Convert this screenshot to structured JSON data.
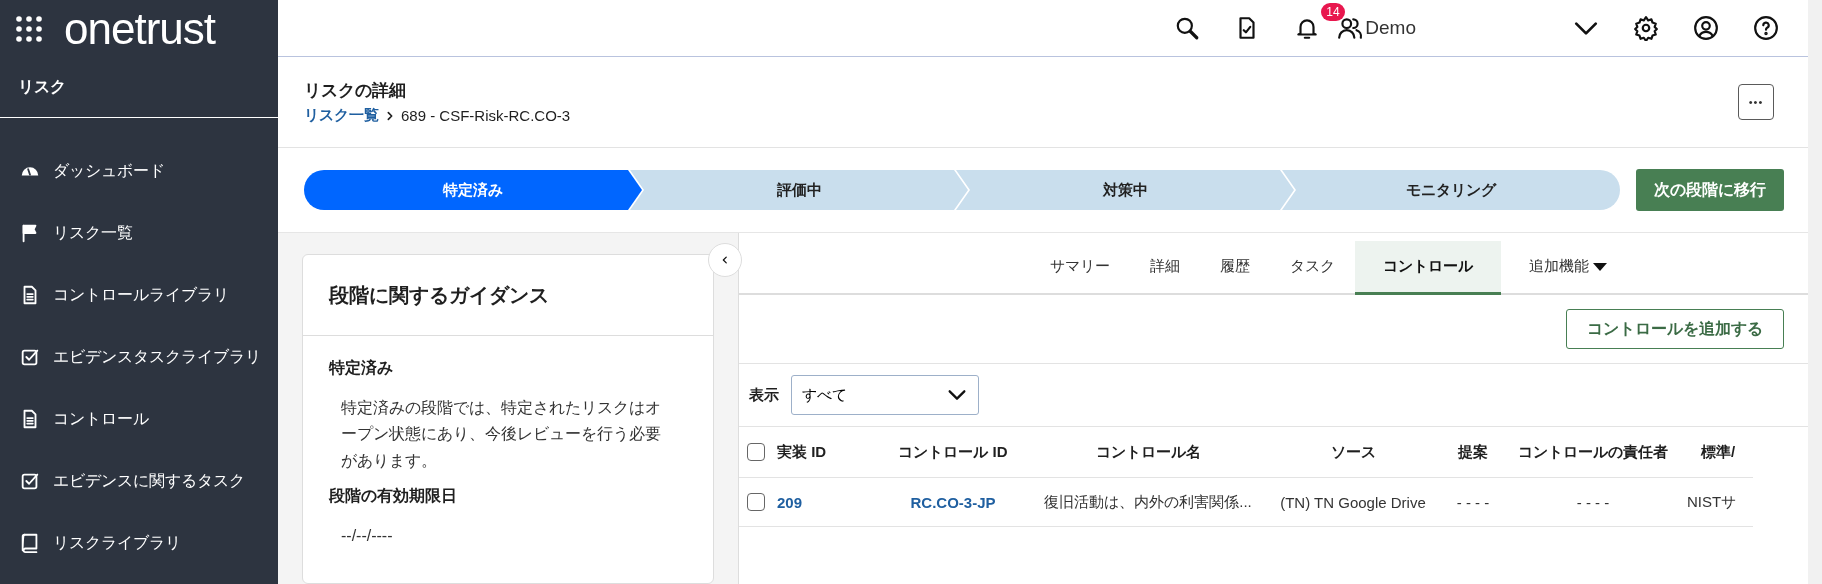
{
  "brand": {
    "logo": "onetrust",
    "module": "リスク"
  },
  "sidebar": {
    "items": [
      {
        "label": "ダッシュボード",
        "kind": "dashboard"
      },
      {
        "label": "リスク一覧",
        "kind": "flag"
      },
      {
        "label": "コントロールライブラリ",
        "kind": "document"
      },
      {
        "label": "エビデンスタスクライブラリ",
        "kind": "task"
      },
      {
        "label": "コントロール",
        "kind": "document"
      },
      {
        "label": "エビデンスに関するタスク",
        "kind": "task"
      },
      {
        "label": "リスクライブラリ",
        "kind": "book"
      }
    ]
  },
  "topbar": {
    "notifications": "14",
    "user": "Demo"
  },
  "header": {
    "title": "リスクの詳細",
    "breadcrumb_link": "リスク一覧",
    "breadcrumb_current": "689 - CSF-Risk-RC.CO-3",
    "more": "•••"
  },
  "stages": [
    {
      "label": "特定済み",
      "selected": true
    },
    {
      "label": "評価中",
      "selected": false
    },
    {
      "label": "対策中",
      "selected": false
    },
    {
      "label": "モニタリング",
      "selected": false
    }
  ],
  "next_stage_button": "次の段階に移行",
  "guidance": {
    "title": "段階に関するガイダンス",
    "stage_heading": "特定済み",
    "description": "特定済みの段階では、特定されたリスクはオープン状態にあり、今後レビューを行う必要があります。",
    "expiry_heading": "段階の有効期限日",
    "expiry_value": "--/--/----"
  },
  "tabs": [
    {
      "label": "サマリー",
      "selected": false
    },
    {
      "label": "詳細",
      "selected": false
    },
    {
      "label": "履歴",
      "selected": false
    },
    {
      "label": "タスク",
      "selected": false
    },
    {
      "label": "コントロール",
      "selected": true
    },
    {
      "label": "追加機能",
      "selected": false,
      "kind": "menu"
    }
  ],
  "add_control_button": "コントロールを追加する",
  "filter": {
    "label": "表示",
    "value": "すべて"
  },
  "table": {
    "all_checked": false,
    "columns": [
      "実装 ID",
      "コントロール ID",
      "コントロール名",
      "ソース",
      "提案",
      "コントロールの責任者",
      "標準/"
    ],
    "rows": [
      {
        "checked": false,
        "cells": [
          "209",
          "RC.CO-3-JP",
          "復旧活動は、内外の利害関係...",
          "(TN) TN Google Drive",
          "- - - -",
          "- - - -",
          "NISTサ"
        ]
      }
    ]
  }
}
